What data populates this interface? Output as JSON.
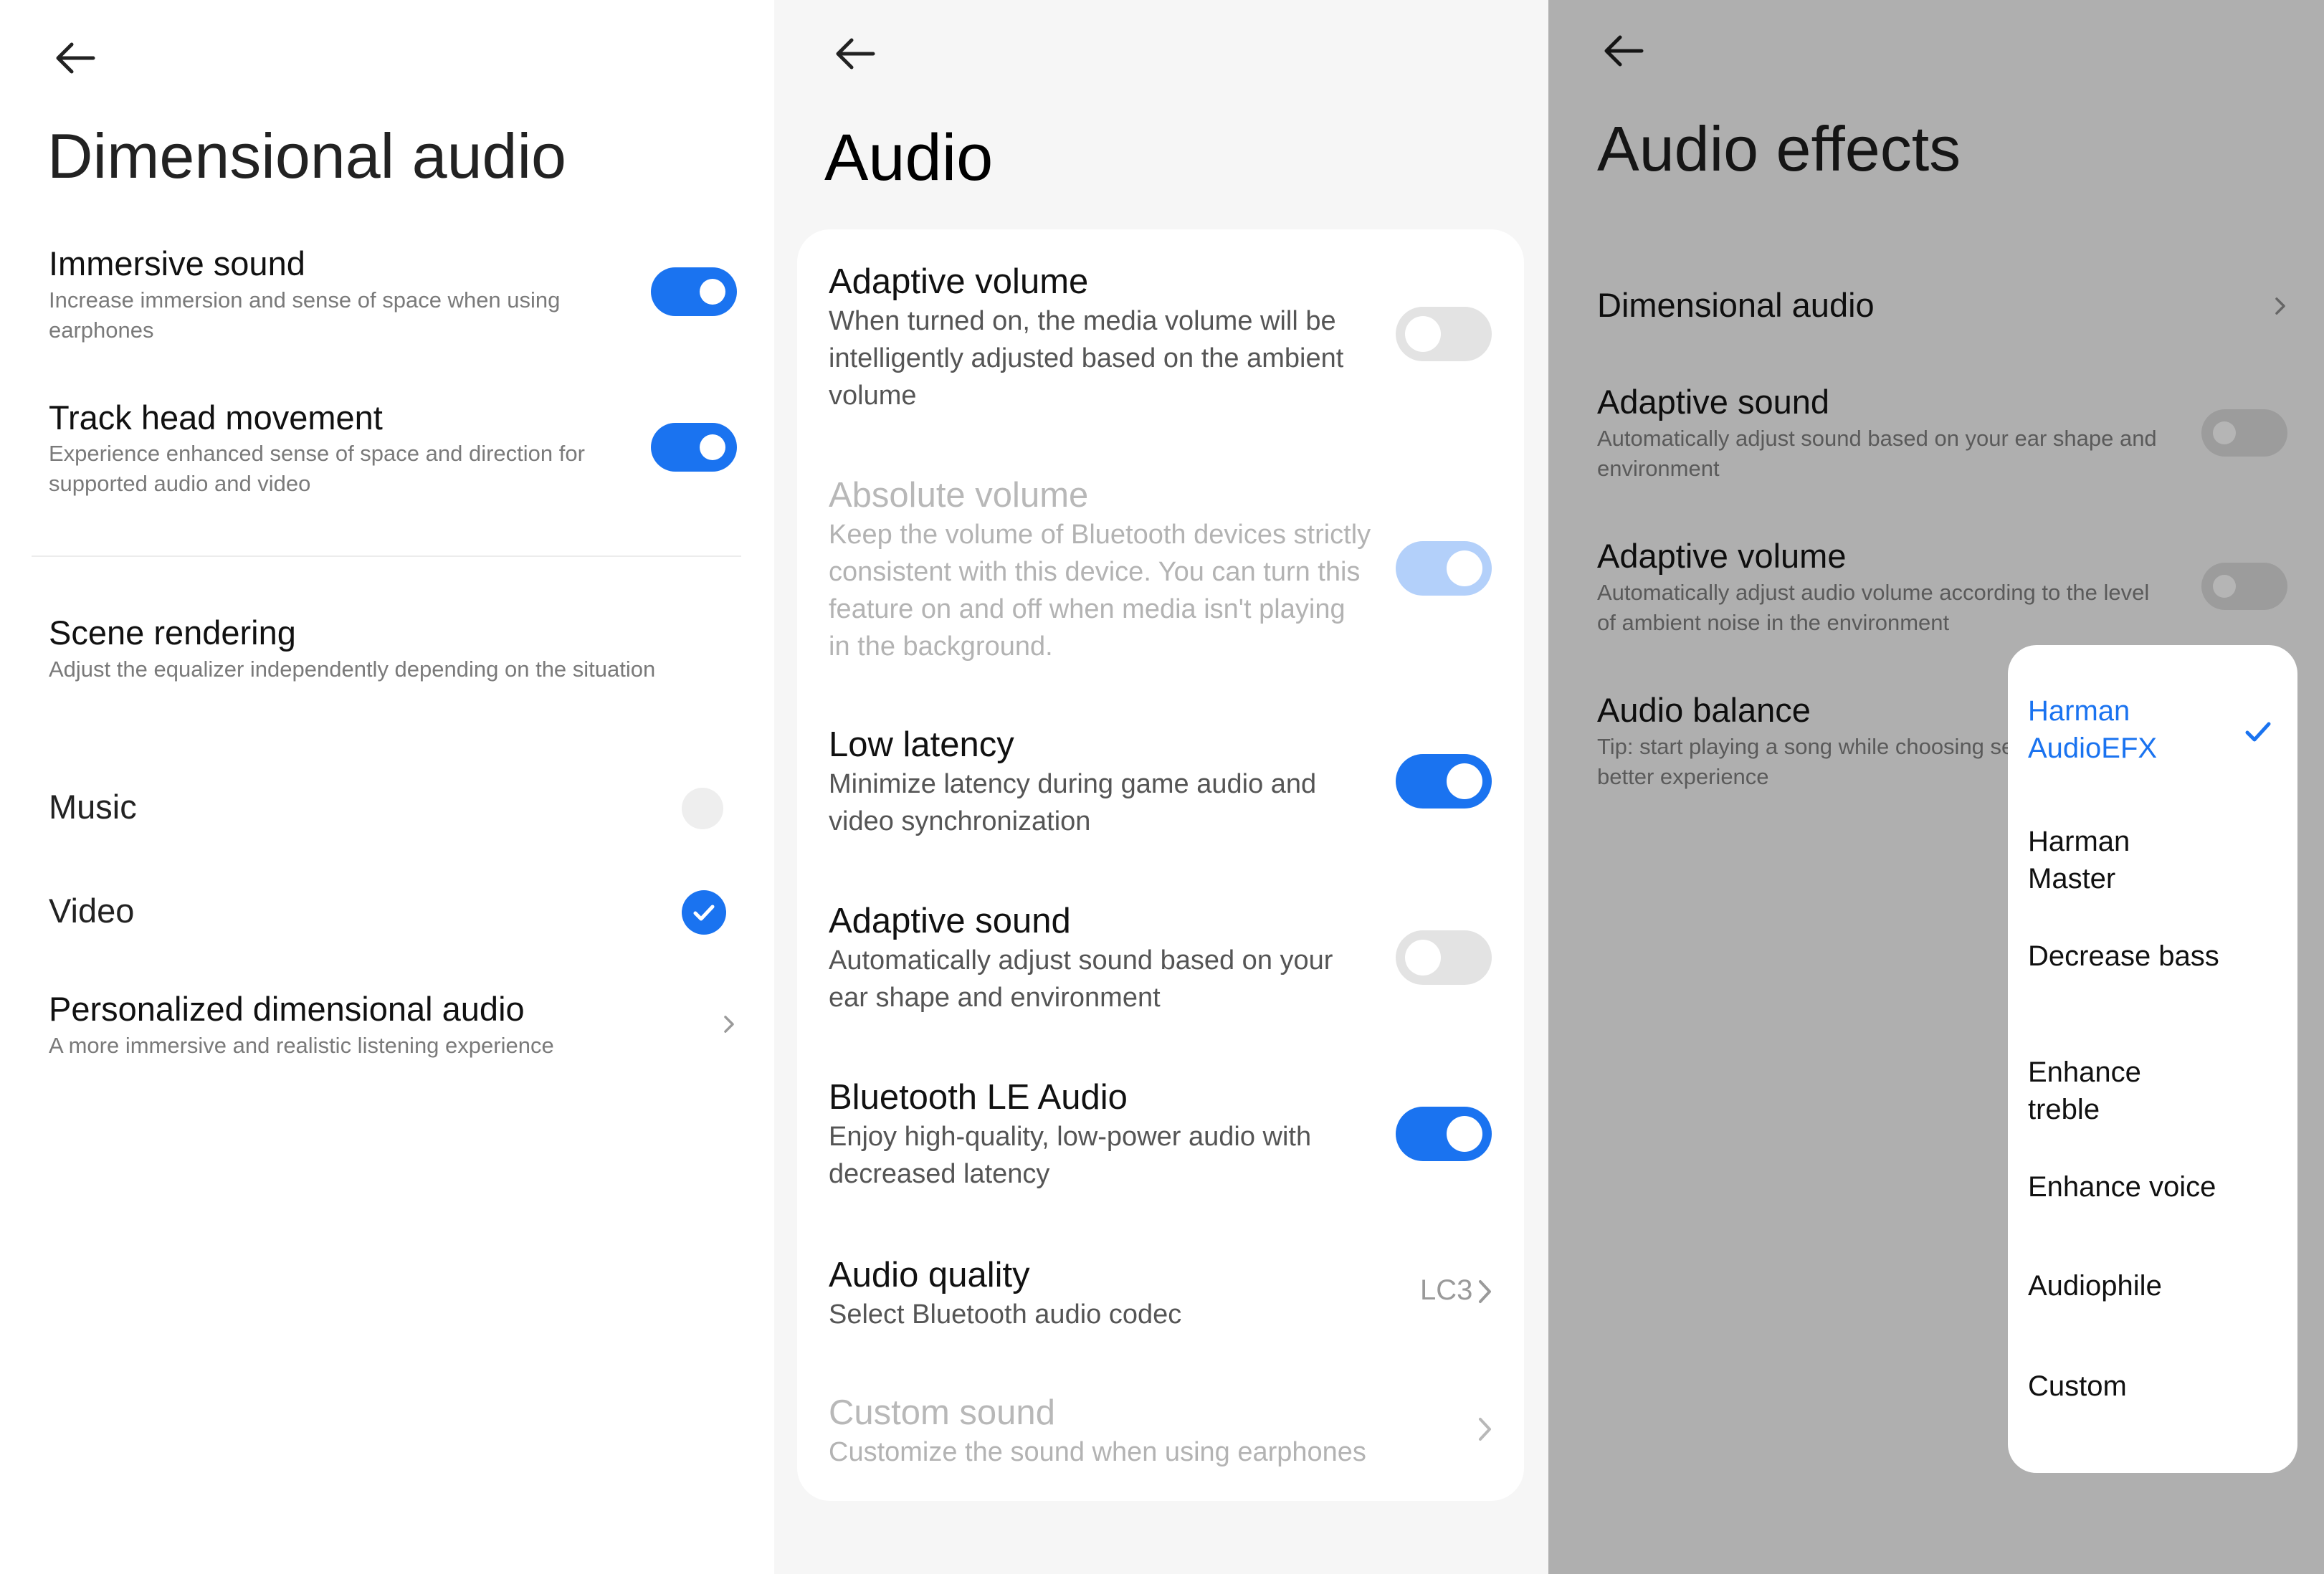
{
  "panel1": {
    "back_icon": "arrow-left-icon",
    "title": "Dimensional audio",
    "immersive": {
      "title": "Immersive sound",
      "subtitle": "Increase immersion and sense of space when using earphones",
      "on": true
    },
    "head": {
      "title": "Track head movement",
      "subtitle": "Experience enhanced sense of space and direction for supported audio and video",
      "on": true
    },
    "scene": {
      "title": "Scene rendering",
      "subtitle": "Adjust the equalizer independently depending on the situation"
    },
    "options": [
      {
        "label": "Music",
        "selected": false
      },
      {
        "label": "Video",
        "selected": true
      }
    ],
    "personalized": {
      "title": "Personalized dimensional audio",
      "subtitle": "A more immersive and realistic listening experience"
    },
    "accent": "#1a73f0"
  },
  "panel2": {
    "back_icon": "arrow-left-icon",
    "title": "Audio",
    "items": [
      {
        "title": "Adaptive volume",
        "subtitle": "When turned on, the media volume will be intelligently adjusted based on the ambient volume",
        "state": "off"
      },
      {
        "title": "Absolute volume",
        "subtitle": "Keep the volume of Bluetooth devices strictly consistent with this device. You can turn this feature on and off when media isn't playing in the background.",
        "state": "on-disabled"
      },
      {
        "title": "Low latency",
        "subtitle": "Minimize latency during game audio and video synchronization",
        "state": "on"
      },
      {
        "title": "Adaptive sound",
        "subtitle": "Automatically adjust sound based on your ear shape and environment",
        "state": "off"
      },
      {
        "title": "Bluetooth LE Audio",
        "subtitle": "Enjoy high-quality, low-power audio with decreased latency",
        "state": "on"
      }
    ],
    "quality": {
      "title": "Audio quality",
      "subtitle": "Select Bluetooth audio codec",
      "value": "LC3"
    },
    "custom": {
      "title": "Custom sound",
      "subtitle": "Customize the sound when using earphones"
    }
  },
  "panel3": {
    "back_icon": "arrow-left-icon",
    "title": "Audio effects",
    "dimensional": {
      "title": "Dimensional audio"
    },
    "adaptive_sound": {
      "title": "Adaptive sound",
      "subtitle": "Automatically adjust sound based on your ear shape and environment"
    },
    "adaptive_volume": {
      "title": "Adaptive volume",
      "subtitle": "Automatically adjust audio volume according to the level of ambient noise in the environment"
    },
    "balance": {
      "title": "Audio balance",
      "subtitle": "Tip: start playing a song while choosing settings for a better experience"
    },
    "menu": [
      {
        "label": "Harman AudioEFX",
        "selected": true
      },
      {
        "label": "Harman Master",
        "selected": false
      },
      {
        "label": "Decrease bass",
        "selected": false
      },
      {
        "label": "Enhance treble",
        "selected": false
      },
      {
        "label": "Enhance voice",
        "selected": false
      },
      {
        "label": "Audiophile",
        "selected": false
      },
      {
        "label": "Custom",
        "selected": false
      }
    ]
  }
}
